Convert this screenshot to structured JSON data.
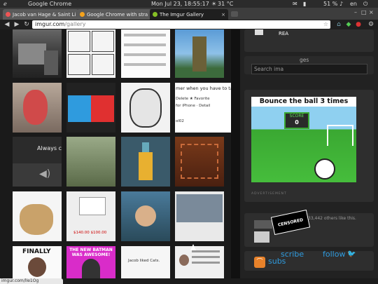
{
  "system_bar": {
    "app_name": "Google Chrome",
    "datetime": "Mon Jul 23, 18:55:17",
    "temperature": "31 °C",
    "battery": "51 %",
    "language": "en"
  },
  "tabs": [
    {
      "label": "Jacob van Hage & Saint Li",
      "active": false
    },
    {
      "label": "Google Chrome with stra",
      "active": false
    },
    {
      "label": "The Imgur Gallery",
      "active": true
    }
  ],
  "address_bar": {
    "scheme": "",
    "host": "imgur.com",
    "path": "/gallery"
  },
  "gallery": {
    "tiles": [
      {
        "caption": ""
      },
      {
        "caption": ""
      },
      {
        "caption": ""
      },
      {
        "caption": ""
      },
      {
        "caption": ""
      },
      {
        "caption": ""
      },
      {
        "caption": ""
      },
      {
        "caption": "mer when you have to ta"
      },
      {
        "caption": "Always ch"
      },
      {
        "caption": ""
      },
      {
        "caption": ""
      },
      {
        "caption": ""
      },
      {
        "caption": ""
      },
      {
        "caption": "$140.00 $100.00"
      },
      {
        "caption": ""
      },
      {
        "caption": ""
      },
      {
        "caption": "FINALLY"
      },
      {
        "caption": "THE NEW BATMAN WAS AWESOME!"
      },
      {
        "caption": "Jacob liked Cats."
      },
      {
        "caption": ""
      }
    ],
    "tile4_sub": "Delete  ★ Favorite",
    "tile4_sub2": "for iPhone · Detail",
    "tile4_sub3": "ol02"
  },
  "sidebar": {
    "top_label": "REA",
    "search_placeholder": "Search ima",
    "search_suffix": "ges",
    "game_title": "Bounce the ball 3 times",
    "game_score_label": "SCORE",
    "game_score_value": "0",
    "ad_label": "ADVERTISEMENT",
    "censored_text": "CENSORED",
    "likes_text": "33,442 others like this.",
    "subscribe_label": "subs",
    "subscribe_label2": "scribe",
    "follow_label": "follow"
  },
  "status_bar": {
    "url": "imgur.com/lIe1Og"
  },
  "colors": {
    "accent_blue": "#2f9bde",
    "rss_orange": "#e8822a",
    "game_green": "#3aa832"
  }
}
